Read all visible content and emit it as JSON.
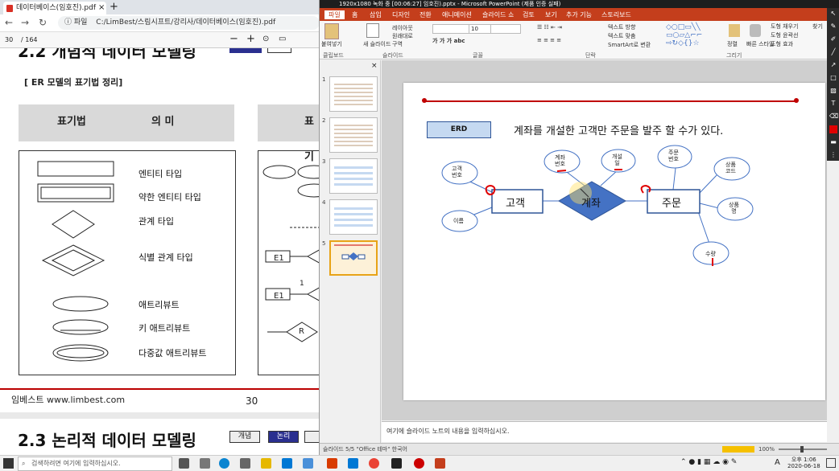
{
  "browser": {
    "tab_title": "데이터베이스(임호진).pdf",
    "tab_close": "×",
    "new_tab": "+",
    "url_prefix": "ⓘ 파일",
    "url": "C:/LimBest/스림시프트/강리사/데이터베이스(임호진).pdf",
    "pdf_toolbar": {
      "page_num": "30",
      "page_total": "/ 164",
      "zoom_minus": "−",
      "zoom_plus": "+"
    }
  },
  "pdf": {
    "section_top": "2.2  개념적 데이터 모델링",
    "subheading": "[ ER 모델의  표기법 정리]",
    "table": {
      "col1": "표기법",
      "col2": "의 미",
      "col3": "표기"
    },
    "rows": [
      "엔티티 타입",
      "약한 엔티티 타입",
      "관계 타입",
      "식별 관계 타입",
      "애트리뷰트",
      "키 애트리뷰트",
      "다중값 애트리뷰트"
    ],
    "right_labels": {
      "e1a": "E1",
      "e1b": "E1",
      "one": "1",
      "r": "R"
    },
    "footer_left": "임베스트 www.limbest.com",
    "footer_page": "30",
    "section_bottom": "2.3  논리적 데이터 모델링",
    "section_pills": [
      "개념",
      "논리"
    ]
  },
  "ppt": {
    "title_bar": "1920x1080          녹화 중 [00:06:27]                      임호진).pptx - Microsoft PowerPoint (제품 인증 실패)",
    "tabs": [
      "파일",
      "홈",
      "삽입",
      "디자인",
      "전환",
      "애니메이션",
      "슬라이드 쇼",
      "검토",
      "보기",
      "추가 기능",
      "스토리보드"
    ],
    "ribbon": {
      "paste": "붙여넣기",
      "new_slide": "새 슬라이드",
      "layout": "레이아웃",
      "reset": "원래대로",
      "section": "구역",
      "group_clipboard": "클립보드",
      "group_slides": "슬라이드",
      "group_font": "글꼴",
      "group_paragraph": "단락",
      "group_drawing": "그리기",
      "text_direction": "텍스트 방향",
      "text_align": "텍스트 맞춤",
      "smartart": "SmartArt로 변환",
      "arrange": "정렬",
      "quick_styles": "빠른 스타일",
      "shape_fill": "도형 채우기",
      "shape_outline": "도형 윤곽선",
      "shape_effects": "도형 효과",
      "find": "찾기"
    },
    "thumbs": [
      "1",
      "2",
      "3",
      "4",
      "5"
    ],
    "slide": {
      "erd_label": "ERD",
      "heading": "계좌를 개설한 고객만 주문을 발주 할 수가 있다.",
      "entity_customer": "고객",
      "relationship": "계좌",
      "entity_order": "주문",
      "attr_customer_no": "고객\n번호",
      "attr_name": "이름",
      "attr_account_no": "계좌\n번호",
      "attr_open_date": "개설\n일",
      "attr_order_no": "주문\n번호",
      "attr_product_code": "상품\n코드",
      "attr_product_name": "상품\n명",
      "attr_quantity": "수량"
    },
    "notes": "여기에 슬라이드 노트의 내용을 입력하십시오.",
    "status_left": "슬라이드 5/5   \"Office 테마\"   한국어",
    "status_zoom": "100%"
  },
  "taskbar": {
    "search_placeholder": "검색하려면 여기에 입력하십시오.",
    "time": "오후 1:06",
    "date": "2020-06-18",
    "lang": "A"
  },
  "colors": {
    "ppt_accent": "#c43e1c",
    "entity_fill": "#ffffff",
    "entity_border": "#2f5597",
    "relation_fill": "#4472c4",
    "pen_red": "#e00000"
  }
}
